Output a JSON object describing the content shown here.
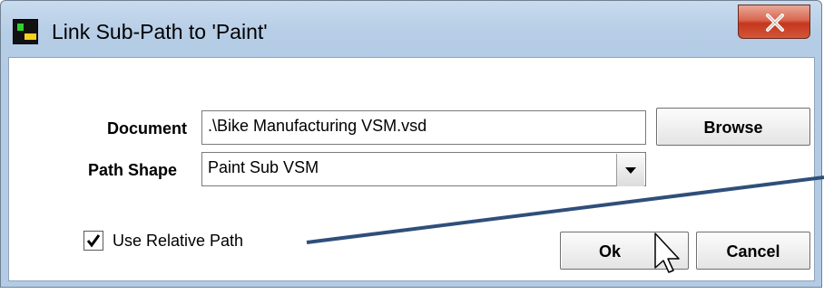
{
  "window": {
    "title": "Link Sub-Path to 'Paint'"
  },
  "form": {
    "document_label": "Document",
    "document_value": ".\\Bike Manufacturing VSM.vsd",
    "browse_label": "Browse",
    "path_shape_label": "Path Shape",
    "path_shape_value": "Paint Sub VSM",
    "use_relative_label": "Use Relative Path",
    "use_relative_checked": true
  },
  "buttons": {
    "ok_label": "Ok",
    "cancel_label": "Cancel"
  },
  "colors": {
    "close_button": "#d24a2e",
    "annotation_line": "#2f4f7a"
  },
  "icons": [
    "app-icon",
    "close-icon",
    "checkmark-icon",
    "chevron-down-icon",
    "mouse-pointer-icon"
  ]
}
